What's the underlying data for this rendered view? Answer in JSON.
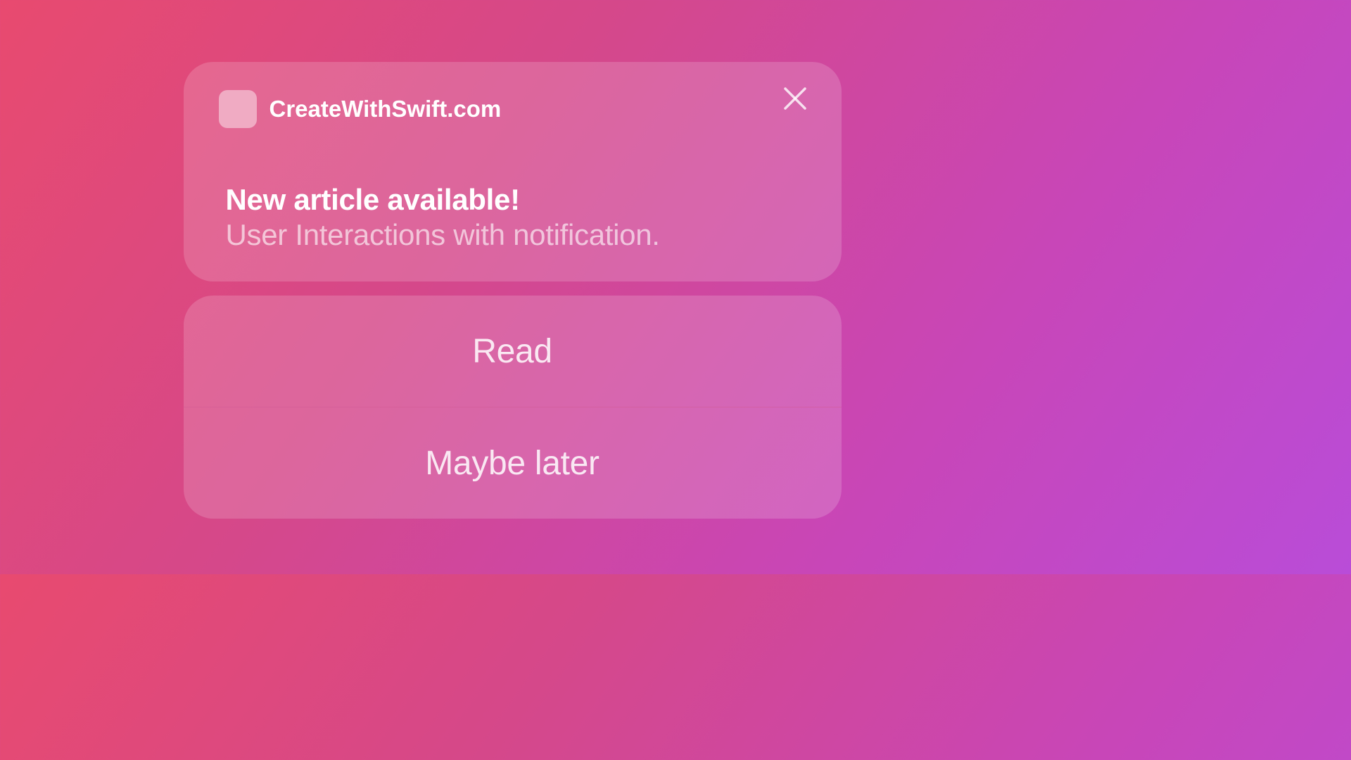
{
  "notification": {
    "app_name": "CreateWithSwift.com",
    "title": "New article available!",
    "subtitle": "User Interactions with notification."
  },
  "actions": {
    "primary": "Read",
    "secondary": "Maybe later"
  }
}
